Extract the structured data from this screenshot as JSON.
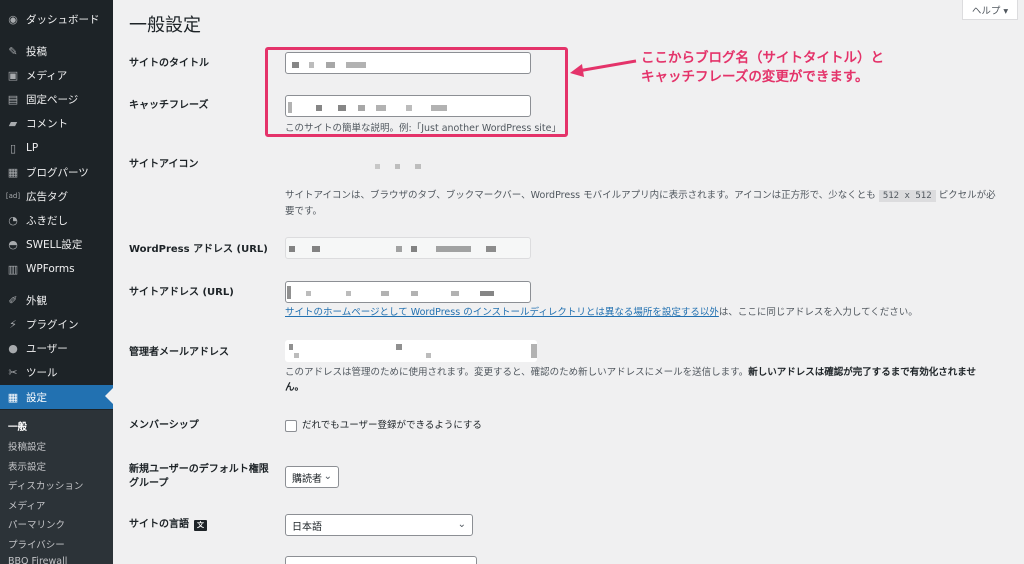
{
  "sidebar": {
    "items": [
      {
        "label": "ダッシュボード",
        "icon": "dashboard-icon",
        "glyph": "◉"
      },
      {
        "label": "投稿",
        "icon": "pin-icon",
        "glyph": "✎"
      },
      {
        "label": "メディア",
        "icon": "media-icon",
        "glyph": "▣"
      },
      {
        "label": "固定ページ",
        "icon": "pages-icon",
        "glyph": "▤"
      },
      {
        "label": "コメント",
        "icon": "comment-icon",
        "glyph": "▰"
      },
      {
        "label": "LP",
        "icon": "lp-icon",
        "glyph": "▯"
      },
      {
        "label": "ブログパーツ",
        "icon": "blogparts-icon",
        "glyph": "▦"
      },
      {
        "label": "広告タグ",
        "icon": "ad-icon",
        "glyph": "[ad]"
      },
      {
        "label": "ふきだし",
        "icon": "bubble-icon",
        "glyph": "◔"
      },
      {
        "label": "SWELL設定",
        "icon": "swell-icon",
        "glyph": "◓"
      },
      {
        "label": "WPForms",
        "icon": "forms-icon",
        "glyph": "▥"
      },
      {
        "label": "外観",
        "icon": "appearance-icon",
        "glyph": "✐"
      },
      {
        "label": "プラグイン",
        "icon": "plugin-icon",
        "glyph": "⚡"
      },
      {
        "label": "ユーザー",
        "icon": "user-icon",
        "glyph": "●"
      },
      {
        "label": "ツール",
        "icon": "tools-icon",
        "glyph": "✂"
      },
      {
        "label": "設定",
        "icon": "settings-icon",
        "glyph": "▦"
      }
    ],
    "submenu": [
      "一般",
      "投稿設定",
      "表示設定",
      "ディスカッション",
      "メディア",
      "パーマリンク",
      "プライバシー",
      "BBQ Firewall"
    ]
  },
  "header": {
    "title": "一般設定",
    "help": "ヘルプ ▾"
  },
  "form": {
    "site_title_label": "サイトのタイトル",
    "tagline_label": "キャッチフレーズ",
    "tagline_desc": "このサイトの簡単な説明。例:「Just another WordPress site」",
    "site_icon_label": "サイトアイコン",
    "site_icon_desc_1": "サイトアイコンは、ブラウザのタブ、ブックマークバー、WordPress モバイルアプリ内に表示されます。アイコンは正方形で、少なくとも",
    "site_icon_code": "512 x 512",
    "site_icon_desc_2": "ピクセルが必",
    "site_icon_desc_3": "要です。",
    "wp_address_label": "WordPress アドレス (URL)",
    "site_address_label": "サイトアドレス (URL)",
    "site_address_link": "サイトのホームページとして WordPress のインストールディレクトリとは異なる場所を設定する以外",
    "site_address_desc": "は、ここに同じアドレスを入力してください。",
    "admin_email_label": "管理者メールアドレス",
    "admin_email_desc": "このアドレスは管理のために使用されます。変更すると、確認のため新しいアドレスにメールを送信します。",
    "admin_email_desc_bold_1": "新しいアドレスは確認が完了するまで有効化されませ",
    "admin_email_desc_bold_2": "ん。",
    "membership_label": "メンバーシップ",
    "membership_checkbox": "だれでもユーザー登録ができるようにする",
    "default_role_label_1": "新規ユーザーのデフォルト権限",
    "default_role_label_2": "グループ",
    "default_role_value": "購読者",
    "language_label": "サイトの言語",
    "language_value": "日本語"
  },
  "annotation": {
    "line1": "ここからブログ名（サイトタイトル）と",
    "line2": "キャッチフレーズの変更ができます。",
    "color": "#e4336a"
  },
  "colors": {
    "sidebar_bg": "#1d2327",
    "active": "#2271b1",
    "link": "#2271b1"
  }
}
